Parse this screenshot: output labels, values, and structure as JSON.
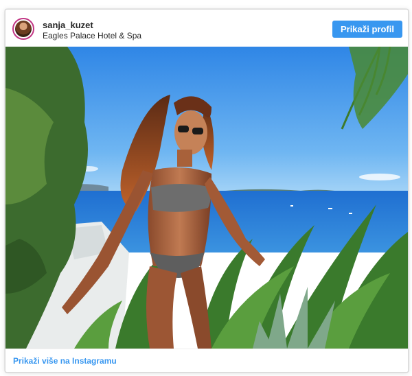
{
  "post": {
    "username": "sanja_kuzet",
    "location": "Eagles Palace Hotel & Spa",
    "profile_button_label": "Prikaži profil",
    "more_link_label": "Prikaži više na Instagramu"
  },
  "icons": {
    "avatar": "profile-avatar"
  },
  "colors": {
    "accent": "#3897f0",
    "text": "#262626",
    "border": "#dbdbdb"
  }
}
